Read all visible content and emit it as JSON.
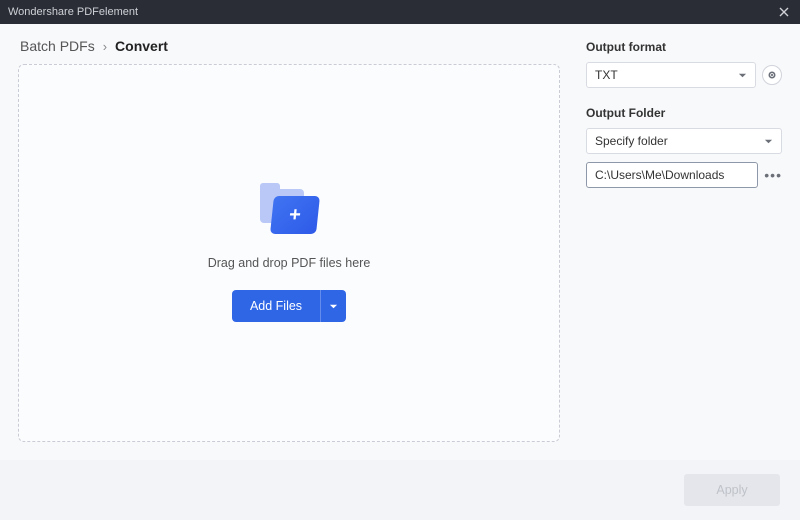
{
  "titlebar": {
    "app_name": "Wondershare PDFelement"
  },
  "breadcrumb": {
    "root": "Batch PDFs",
    "current": "Convert"
  },
  "dropzone": {
    "hint": "Drag and drop PDF files here",
    "add_files_label": "Add Files"
  },
  "side": {
    "output_format_label": "Output format",
    "output_format_value": "TXT",
    "output_folder_label": "Output Folder",
    "folder_mode_value": "Specify folder",
    "folder_path_value": "C:\\Users\\Me\\Downloads"
  },
  "footer": {
    "apply_label": "Apply"
  },
  "icons": {
    "close": "close-icon",
    "chevron_down": "chevron-down-icon",
    "gear": "gear-icon",
    "browse": "browse-icon",
    "folder_plus": "folder-plus-icon"
  }
}
